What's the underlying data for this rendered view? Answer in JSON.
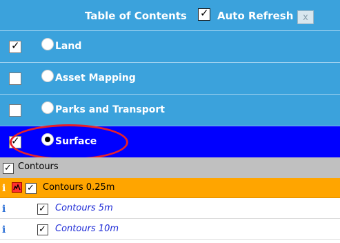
{
  "header": {
    "title": "Table of Contents",
    "auto_refresh_label": "Auto Refresh",
    "auto_refresh_checked": true,
    "close_label": "x"
  },
  "layers": [
    {
      "label": "Land",
      "checked": true,
      "radio_selected": false
    },
    {
      "label": "Asset Mapping",
      "checked": false,
      "radio_selected": false
    },
    {
      "label": "Parks and Transport",
      "checked": false,
      "radio_selected": false
    },
    {
      "label": "Surface",
      "checked": true,
      "radio_selected": true
    }
  ],
  "group": {
    "label": "Contours",
    "checked": true
  },
  "sublayers": [
    {
      "label": "Contours 0.25m",
      "info": "i",
      "checked": true
    },
    {
      "label": "Contours 5m",
      "info": "i",
      "checked": true
    },
    {
      "label": "Contours 10m",
      "info": "i",
      "checked": true
    }
  ],
  "icons": {
    "info": "info-icon",
    "legend": "legend-icon",
    "check": "checkmark-icon",
    "radio": "radio-icon"
  },
  "colors": {
    "header_bg": "#3ba2dc",
    "active_row_bg": "#0000ff",
    "selected_sublayer_bg": "#ffa500",
    "group_bg": "#c0c0c0",
    "highlight": "#e5202b"
  }
}
